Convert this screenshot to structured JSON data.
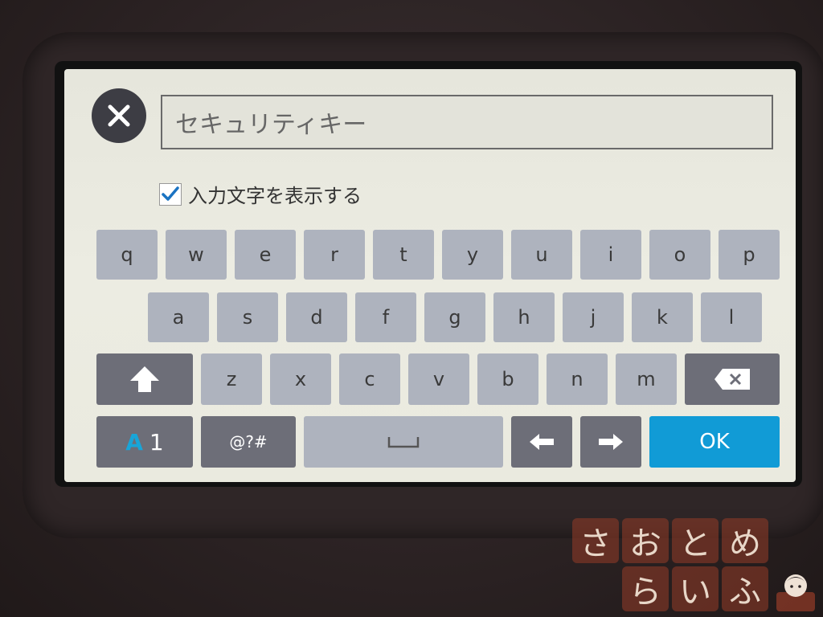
{
  "dialog": {
    "field_placeholder": "セキュリティキー",
    "show_input_label": "入力文字を表示する",
    "show_input_checked": true
  },
  "keyboard": {
    "row1": [
      "q",
      "w",
      "e",
      "r",
      "t",
      "y",
      "u",
      "i",
      "o",
      "p"
    ],
    "row2": [
      "a",
      "s",
      "d",
      "f",
      "g",
      "h",
      "j",
      "k",
      "l"
    ],
    "row3": [
      "z",
      "x",
      "c",
      "v",
      "b",
      "n",
      "m"
    ],
    "mode_key": {
      "alpha": "A",
      "num": "1"
    },
    "symbols_key": "@?#",
    "space_key": "⎵",
    "ok_key": "OK"
  },
  "icons": {
    "close": "close-icon",
    "shift": "shift-arrow-icon",
    "backspace": "backspace-icon",
    "left": "left-arrow-icon",
    "right": "right-arrow-icon"
  },
  "watermark": {
    "line1": [
      "さ",
      "お",
      "と",
      "め"
    ],
    "line2": [
      "ら",
      "い",
      "ふ"
    ]
  },
  "colors": {
    "ok_blue": "#119bd6",
    "key_light": "#aeb3be",
    "key_dark": "#6d6e78",
    "mode_accent": "#18a5d8"
  }
}
